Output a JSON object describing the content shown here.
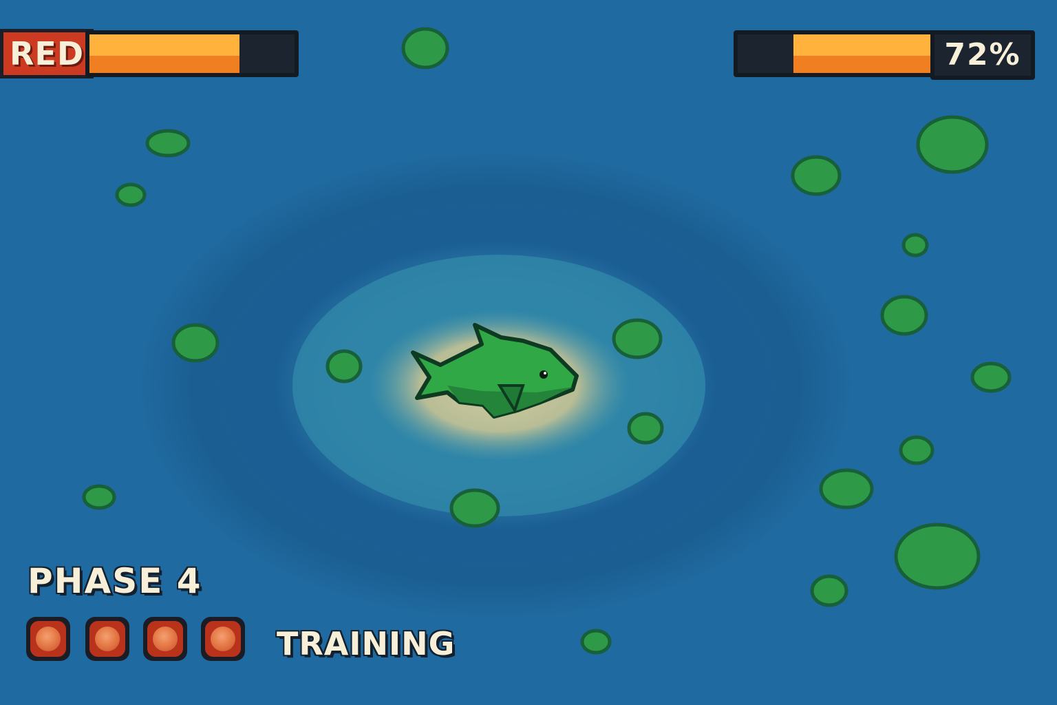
{
  "player1": {
    "name": "RED",
    "health_fill": 0.73,
    "tag_color": "#cc3a22"
  },
  "player2": {
    "health_percent_label": "72%",
    "health_fill": 0.72
  },
  "phase": {
    "label": "PHASE 4"
  },
  "tokens": {
    "count": 4,
    "icon": "coral-orb-icon",
    "color": "#e57b48"
  },
  "status": {
    "label": "TRAINING"
  },
  "scene": {
    "creature": "green-shark-icon",
    "foliage_icon": "seaweed-bush-icon",
    "colors": {
      "water": "#1f6aa0",
      "deep_water": "#1a5a8c",
      "shallow": "#3f8fa8",
      "sand": "#c9c59a",
      "shark": "#2fa845",
      "foliage": "#2e9a48",
      "bar_fill": "#ffb23c"
    }
  }
}
